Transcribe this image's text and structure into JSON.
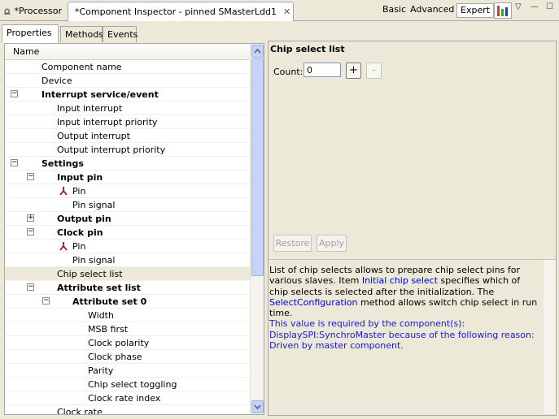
{
  "top_tabs": [
    {
      "label": "*Processor"
    },
    {
      "label": "*Component Inspector - pinned SMasterLdd1"
    }
  ],
  "modes": {
    "basic": "Basic",
    "advanced": "Advanced",
    "expert": "Expert"
  },
  "inner_tabs": [
    "Properties",
    "Methods",
    "Events"
  ],
  "tree": {
    "header": "Name",
    "rows": [
      {
        "label": "Component name"
      },
      {
        "label": "Device"
      },
      {
        "label": "Interrupt service/event"
      },
      {
        "label": "Input interrupt"
      },
      {
        "label": "Input interrupt priority"
      },
      {
        "label": "Output interrupt"
      },
      {
        "label": "Output interrupt priority"
      },
      {
        "label": "Settings"
      },
      {
        "label": "Input pin"
      },
      {
        "label": "Pin"
      },
      {
        "label": "Pin signal"
      },
      {
        "label": "Output pin"
      },
      {
        "label": "Clock pin"
      },
      {
        "label": "Pin"
      },
      {
        "label": "Pin signal"
      },
      {
        "label": "Chip select list"
      },
      {
        "label": "Attribute set list"
      },
      {
        "label": "Attribute set 0"
      },
      {
        "label": "Width"
      },
      {
        "label": "MSB first"
      },
      {
        "label": "Clock polarity"
      },
      {
        "label": "Clock phase"
      },
      {
        "label": "Parity"
      },
      {
        "label": "Chip select toggling"
      },
      {
        "label": "Clock rate index"
      },
      {
        "label": "Clock rate"
      }
    ]
  },
  "detail": {
    "title": "Chip select list",
    "count_label": "Count:",
    "count_value": "0",
    "add_label": "+",
    "remove_label": "-",
    "restore_label": "Restore",
    "apply_label": "Apply"
  },
  "help": {
    "p1": "List of chip selects allows to prepare chip select pins for various slaves. Item ",
    "link1": "Initial chip select",
    "p2": " specifies which of chip selects is selected after the initialization. The ",
    "link2": "SelectConfiguration",
    "p3": " method allows switch chip select in run time.",
    "note": "This value is required by the component(s): DisplaySPI:SynchroMaster because of the following reason: Driven by master component."
  },
  "colors": {
    "link": "#0000e0",
    "note": "#1a1ad0",
    "selection": "#ece9d8"
  }
}
